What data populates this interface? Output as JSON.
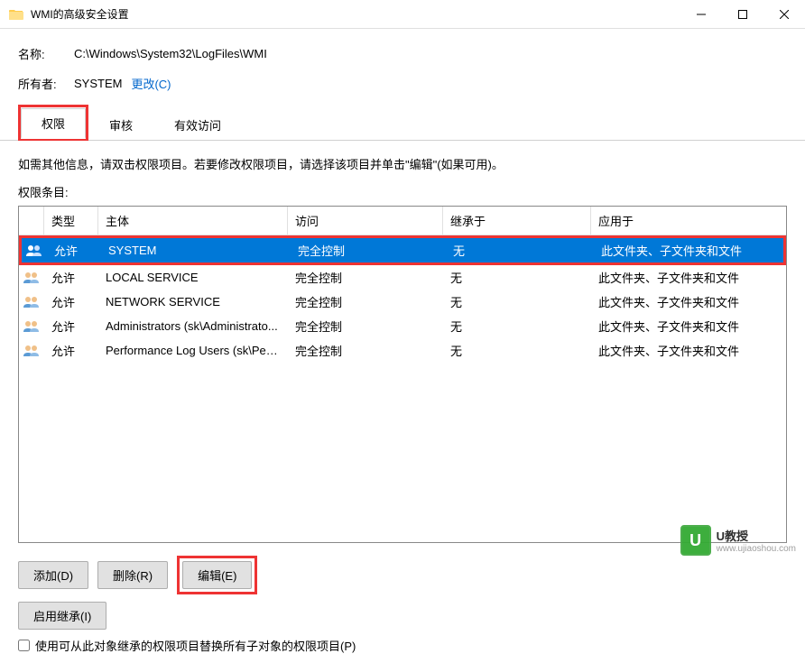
{
  "window": {
    "title": "WMI的高级安全设置",
    "minimize": "—",
    "maximize": "☐",
    "close": "✕"
  },
  "fields": {
    "name_label": "名称:",
    "name_value": "C:\\Windows\\System32\\LogFiles\\WMI",
    "owner_label": "所有者:",
    "owner_value": "SYSTEM",
    "change_link": "更改(C)"
  },
  "tabs": {
    "permissions": "权限",
    "auditing": "审核",
    "effective": "有效访问"
  },
  "instruction_text": "如需其他信息，请双击权限项目。若要修改权限项目，请选择该项目并单击\"编辑\"(如果可用)。",
  "subhead": "权限条目:",
  "table": {
    "headers": {
      "type": "类型",
      "principal": "主体",
      "access": "访问",
      "inherit": "继承于",
      "applies": "应用于"
    },
    "rows": [
      {
        "type": "允许",
        "principal": "SYSTEM",
        "access": "完全控制",
        "inherit": "无",
        "applies": "此文件夹、子文件夹和文件",
        "selected": true
      },
      {
        "type": "允许",
        "principal": "LOCAL SERVICE",
        "access": "完全控制",
        "inherit": "无",
        "applies": "此文件夹、子文件夹和文件",
        "selected": false
      },
      {
        "type": "允许",
        "principal": "NETWORK SERVICE",
        "access": "完全控制",
        "inherit": "无",
        "applies": "此文件夹、子文件夹和文件",
        "selected": false
      },
      {
        "type": "允许",
        "principal": "Administrators (sk\\Administrato...",
        "access": "完全控制",
        "inherit": "无",
        "applies": "此文件夹、子文件夹和文件",
        "selected": false
      },
      {
        "type": "允许",
        "principal": "Performance Log Users (sk\\Perf...",
        "access": "完全控制",
        "inherit": "无",
        "applies": "此文件夹、子文件夹和文件",
        "selected": false
      }
    ]
  },
  "buttons": {
    "add": "添加(D)",
    "remove": "删除(R)",
    "edit": "编辑(E)",
    "enable_inherit": "启用继承(I)"
  },
  "checkbox_label": "使用可从此对象继承的权限项目替换所有子对象的权限项目(P)",
  "watermark": {
    "brand": "U教授",
    "url": "www.ujiaoshou.com"
  }
}
